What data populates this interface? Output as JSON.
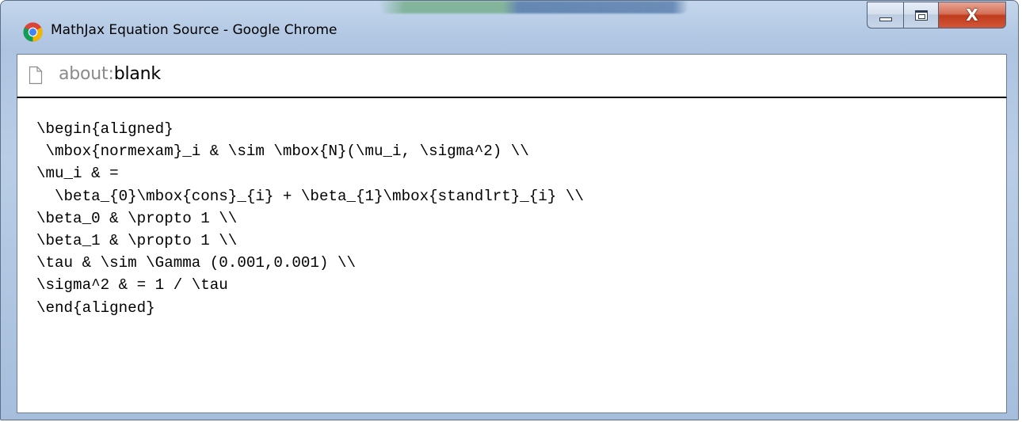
{
  "window": {
    "title": "MathJax Equation Source - Google Chrome",
    "controls": {
      "minimize": "minimize",
      "maximize": "maximize",
      "close": "close"
    }
  },
  "address_bar": {
    "scheme": "about:",
    "host": "blank"
  },
  "content": {
    "lines": [
      "\\begin{aligned}",
      " \\mbox{normexam}_i & \\sim \\mbox{N}(\\mu_i, \\sigma^2) \\\\",
      "\\mu_i & =",
      "  \\beta_{0}\\mbox{cons}_{i} + \\beta_{1}\\mbox{standlrt}_{i} \\\\",
      "\\beta_0 & \\propto 1 \\\\",
      "\\beta_1 & \\propto 1 \\\\",
      "\\tau & \\sim \\Gamma (0.001,0.001) \\\\",
      "\\sigma^2 & = 1 / \\tau",
      "\\end{aligned}"
    ]
  },
  "icons": {
    "app": "chrome-logo-icon",
    "page": "page-icon",
    "close": "close-icon",
    "minimize": "minimize-icon",
    "maximize": "maximize-icon"
  },
  "colors": {
    "frame": "#b4c9e4",
    "close_button": "#c13b1c",
    "text": "#000000",
    "url_scheme": "#8a8a8a"
  }
}
